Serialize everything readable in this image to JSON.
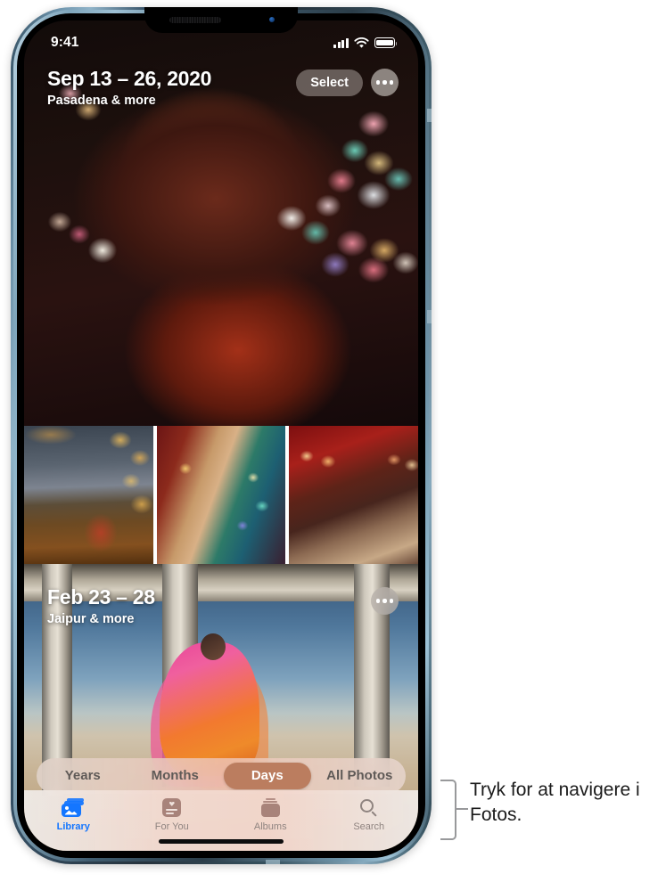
{
  "device": {
    "frame_color": "#6d93ab",
    "notch": {
      "speaker": "speaker-grille",
      "camera": "front-camera"
    }
  },
  "status_bar": {
    "time": "9:41",
    "cellular_icon": "signal-bars-icon",
    "wifi_icon": "wifi-icon",
    "battery_icon": "battery-icon"
  },
  "day_sections": [
    {
      "title": "Sep 13 – 26, 2020",
      "subtitle": "Pasadena & more",
      "select_label": "Select",
      "more_icon": "ellipsis-icon"
    },
    {
      "title": "Feb 23 – 28",
      "subtitle": "Jaipur & more",
      "more_icon": "ellipsis-icon"
    }
  ],
  "thumbnails": [
    {
      "name": "thumbnail-1"
    },
    {
      "name": "thumbnail-2"
    },
    {
      "name": "thumbnail-3"
    }
  ],
  "segmented_control": {
    "selected": "Days",
    "selected_color": "#bb7d5f",
    "items": [
      {
        "label": "Years",
        "selected": false
      },
      {
        "label": "Months",
        "selected": false
      },
      {
        "label": "Days",
        "selected": true
      },
      {
        "label": "All Photos",
        "selected": false
      }
    ]
  },
  "tab_bar": {
    "active_color": "#1476ff",
    "inactive_color": "#8f8480",
    "tabs": [
      {
        "label": "Library",
        "icon": "photo-library-icon",
        "active": true
      },
      {
        "label": "For You",
        "icon": "for-you-card-icon",
        "active": false
      },
      {
        "label": "Albums",
        "icon": "albums-stack-icon",
        "active": false
      },
      {
        "label": "Search",
        "icon": "magnifier-icon",
        "active": false
      }
    ]
  },
  "home_indicator": "home-indicator",
  "callout": {
    "text": "Tryk for at navigere i Fotos."
  }
}
